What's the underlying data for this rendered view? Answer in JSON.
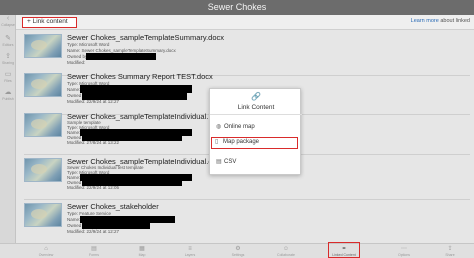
{
  "app": {
    "title": "Sewer Chokes"
  },
  "toolbar": {
    "link_label": "+ Link content",
    "note_text": "about linked",
    "learn_more": "Learn more"
  },
  "left_rail": [
    {
      "label": "Collapse",
      "icon": "chevron-left-icon"
    },
    {
      "label": "Editors",
      "icon": "pencil-icon"
    },
    {
      "label": "Sharing",
      "icon": "share-icon"
    },
    {
      "label": "Files",
      "icon": "folder-icon"
    },
    {
      "label": "Publish",
      "icon": "cloud-icon"
    }
  ],
  "items": [
    {
      "title": "Sewer Chokes_sampleTemplateSummary.docx",
      "meta": [
        "Type: Microsoft Word",
        "Name: Sewer Chokes_sampleTemplateSummary.docx",
        "Owned by",
        "Modified:"
      ]
    },
    {
      "title": "Sewer Chokes Summary Report TEST.docx",
      "meta": [
        "Type: Microsoft Word",
        "Name:",
        "Owned by",
        "Modified: 22/9/24 at 12:27"
      ]
    },
    {
      "title": "Sewer Chokes_sampleTemplateIndividual...",
      "meta": [
        "Sample template",
        "Type: Microsoft Word",
        "Name:",
        "Owned by",
        "Modified: 27/8/24 at 13:22"
      ]
    },
    {
      "title": "Sewer Chokes_sampleTemplateIndividual.docx",
      "meta": [
        "Sewer Chokes Individual test template",
        "Type: Microsoft Word",
        "Name:",
        "Owned by",
        "Modified: 22/9/24 at 12:05"
      ]
    },
    {
      "title": "Sewer Chokes_stakeholder",
      "meta": [
        "Type: Feature Service",
        "Name:",
        "Owned by",
        "Modified: 22/9/24 at 12:27"
      ]
    }
  ],
  "popup": {
    "title": "Link Content",
    "options": [
      {
        "label": "Online map",
        "icon": "globe-icon"
      },
      {
        "label": "Map package",
        "icon": "file-icon"
      },
      {
        "label": "CSV",
        "icon": "document-icon"
      }
    ]
  },
  "bottom_bar": [
    {
      "label": "Overview"
    },
    {
      "label": "Forms"
    },
    {
      "label": "Map"
    },
    {
      "label": "Layers"
    },
    {
      "label": "Settings"
    },
    {
      "label": "Collaborate"
    },
    {
      "label": "Linked Content",
      "active": true
    },
    {
      "label": "Options"
    },
    {
      "label": "Share"
    }
  ],
  "colors": {
    "highlight": "#d92b2b",
    "titlebar": "#6c6c6c",
    "link": "#2a6bb5"
  }
}
